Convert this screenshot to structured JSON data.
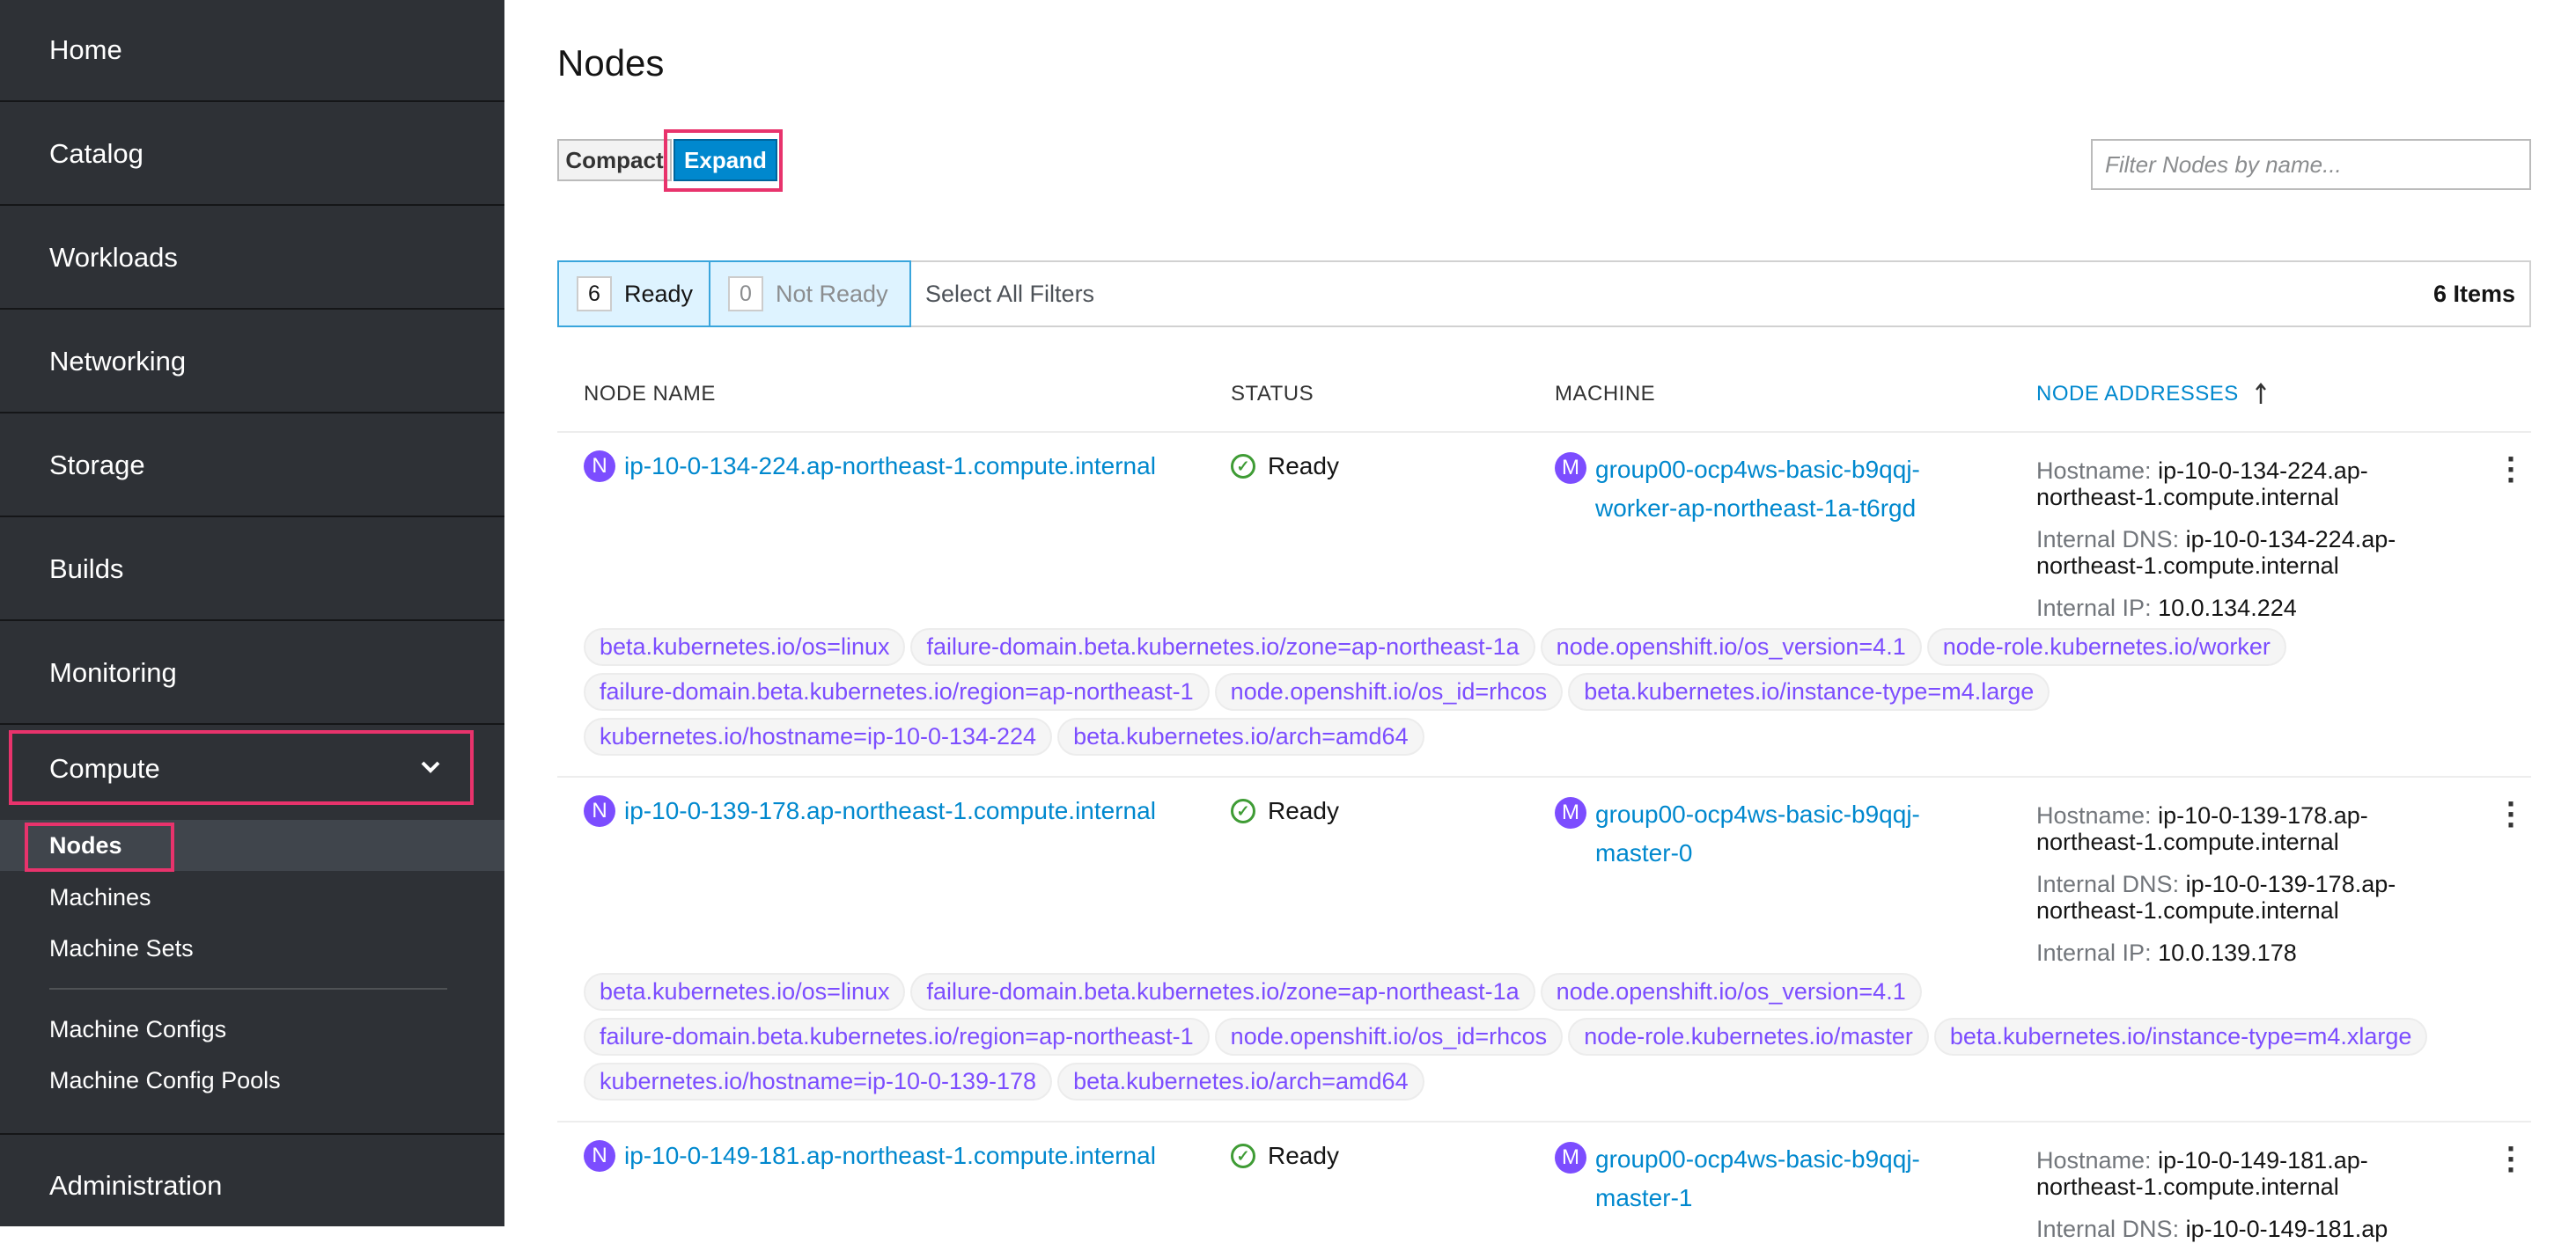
{
  "sidebar": {
    "items": [
      {
        "label": "Home"
      },
      {
        "label": "Catalog"
      },
      {
        "label": "Workloads"
      },
      {
        "label": "Networking"
      },
      {
        "label": "Storage"
      },
      {
        "label": "Builds"
      },
      {
        "label": "Monitoring"
      },
      {
        "label": "Compute"
      },
      {
        "label": "Administration"
      }
    ],
    "compute_subitems": [
      {
        "label": "Nodes"
      },
      {
        "label": "Machines"
      },
      {
        "label": "Machine Sets"
      },
      {
        "label": "Machine Configs"
      },
      {
        "label": "Machine Config Pools"
      }
    ]
  },
  "main": {
    "title": "Nodes",
    "compact_label": "Compact",
    "expand_label": "Expand",
    "filter_placeholder": "Filter Nodes by name...",
    "row_filters": {
      "ready_count": "6",
      "ready_label": "Ready",
      "not_ready_count": "0",
      "not_ready_label": "Not Ready",
      "select_all": "Select All Filters",
      "items_count": "6 Items"
    },
    "columns": {
      "node_name": "NODE NAME",
      "status": "STATUS",
      "machine": "MACHINE",
      "node_addresses": "NODE ADDRESSES"
    },
    "rows": [
      {
        "node_badge": "N",
        "node": "ip-10-0-134-224.ap-northeast-1.compute.internal",
        "status": "Ready",
        "machine_badge": "M",
        "machine": "group00-ocp4ws-basic-b9qqj-worker-ap-northeast-1a-t6rgd",
        "hostname_label": "Hostname:",
        "hostname": "ip-10-0-134-224.ap-northeast-1.compute.internal",
        "dns_label": "Internal DNS:",
        "dns": "ip-10-0-134-224.ap-northeast-1.compute.internal",
        "ip_label": "Internal IP:",
        "ip": "10.0.134.224",
        "labels": [
          "beta.kubernetes.io/os=linux",
          "failure-domain.beta.kubernetes.io/zone=ap-northeast-1a",
          "node.openshift.io/os_version=4.1",
          "node-role.kubernetes.io/worker",
          "failure-domain.beta.kubernetes.io/region=ap-northeast-1",
          "node.openshift.io/os_id=rhcos",
          "beta.kubernetes.io/instance-type=m4.large",
          "kubernetes.io/hostname=ip-10-0-134-224",
          "beta.kubernetes.io/arch=amd64"
        ]
      },
      {
        "node_badge": "N",
        "node": "ip-10-0-139-178.ap-northeast-1.compute.internal",
        "status": "Ready",
        "machine_badge": "M",
        "machine": "group00-ocp4ws-basic-b9qqj-master-0",
        "hostname_label": "Hostname:",
        "hostname": "ip-10-0-139-178.ap-northeast-1.compute.internal",
        "dns_label": "Internal DNS:",
        "dns": "ip-10-0-139-178.ap-northeast-1.compute.internal",
        "ip_label": "Internal IP:",
        "ip": "10.0.139.178",
        "labels": [
          "beta.kubernetes.io/os=linux",
          "failure-domain.beta.kubernetes.io/zone=ap-northeast-1a",
          "node.openshift.io/os_version=4.1",
          "failure-domain.beta.kubernetes.io/region=ap-northeast-1",
          "node.openshift.io/os_id=rhcos",
          "node-role.kubernetes.io/master",
          "beta.kubernetes.io/instance-type=m4.xlarge",
          "kubernetes.io/hostname=ip-10-0-139-178",
          "beta.kubernetes.io/arch=amd64"
        ]
      },
      {
        "node_badge": "N",
        "node": "ip-10-0-149-181.ap-northeast-1.compute.internal",
        "status": "Ready",
        "machine_badge": "M",
        "machine": "group00-ocp4ws-basic-b9qqj-master-1",
        "hostname_label": "Hostname:",
        "hostname": "ip-10-0-149-181.ap-northeast-1.compute.internal",
        "dns_label": "Internal DNS:",
        "dns": "ip-10-0-149-181.ap",
        "ip_label": "",
        "ip": "",
        "labels": []
      }
    ]
  },
  "colors": {
    "sidebar_bg": "#2e3136",
    "link": "#0088ce",
    "label_purple": "#7c4dff",
    "highlight": "#e8336c",
    "ready_green": "#3f9c35"
  },
  "icons": {
    "chevron": "chevron-down-icon",
    "status": "check-circle-icon",
    "sort": "sort-arrow-up-icon",
    "menu": "kebab-menu-icon"
  }
}
